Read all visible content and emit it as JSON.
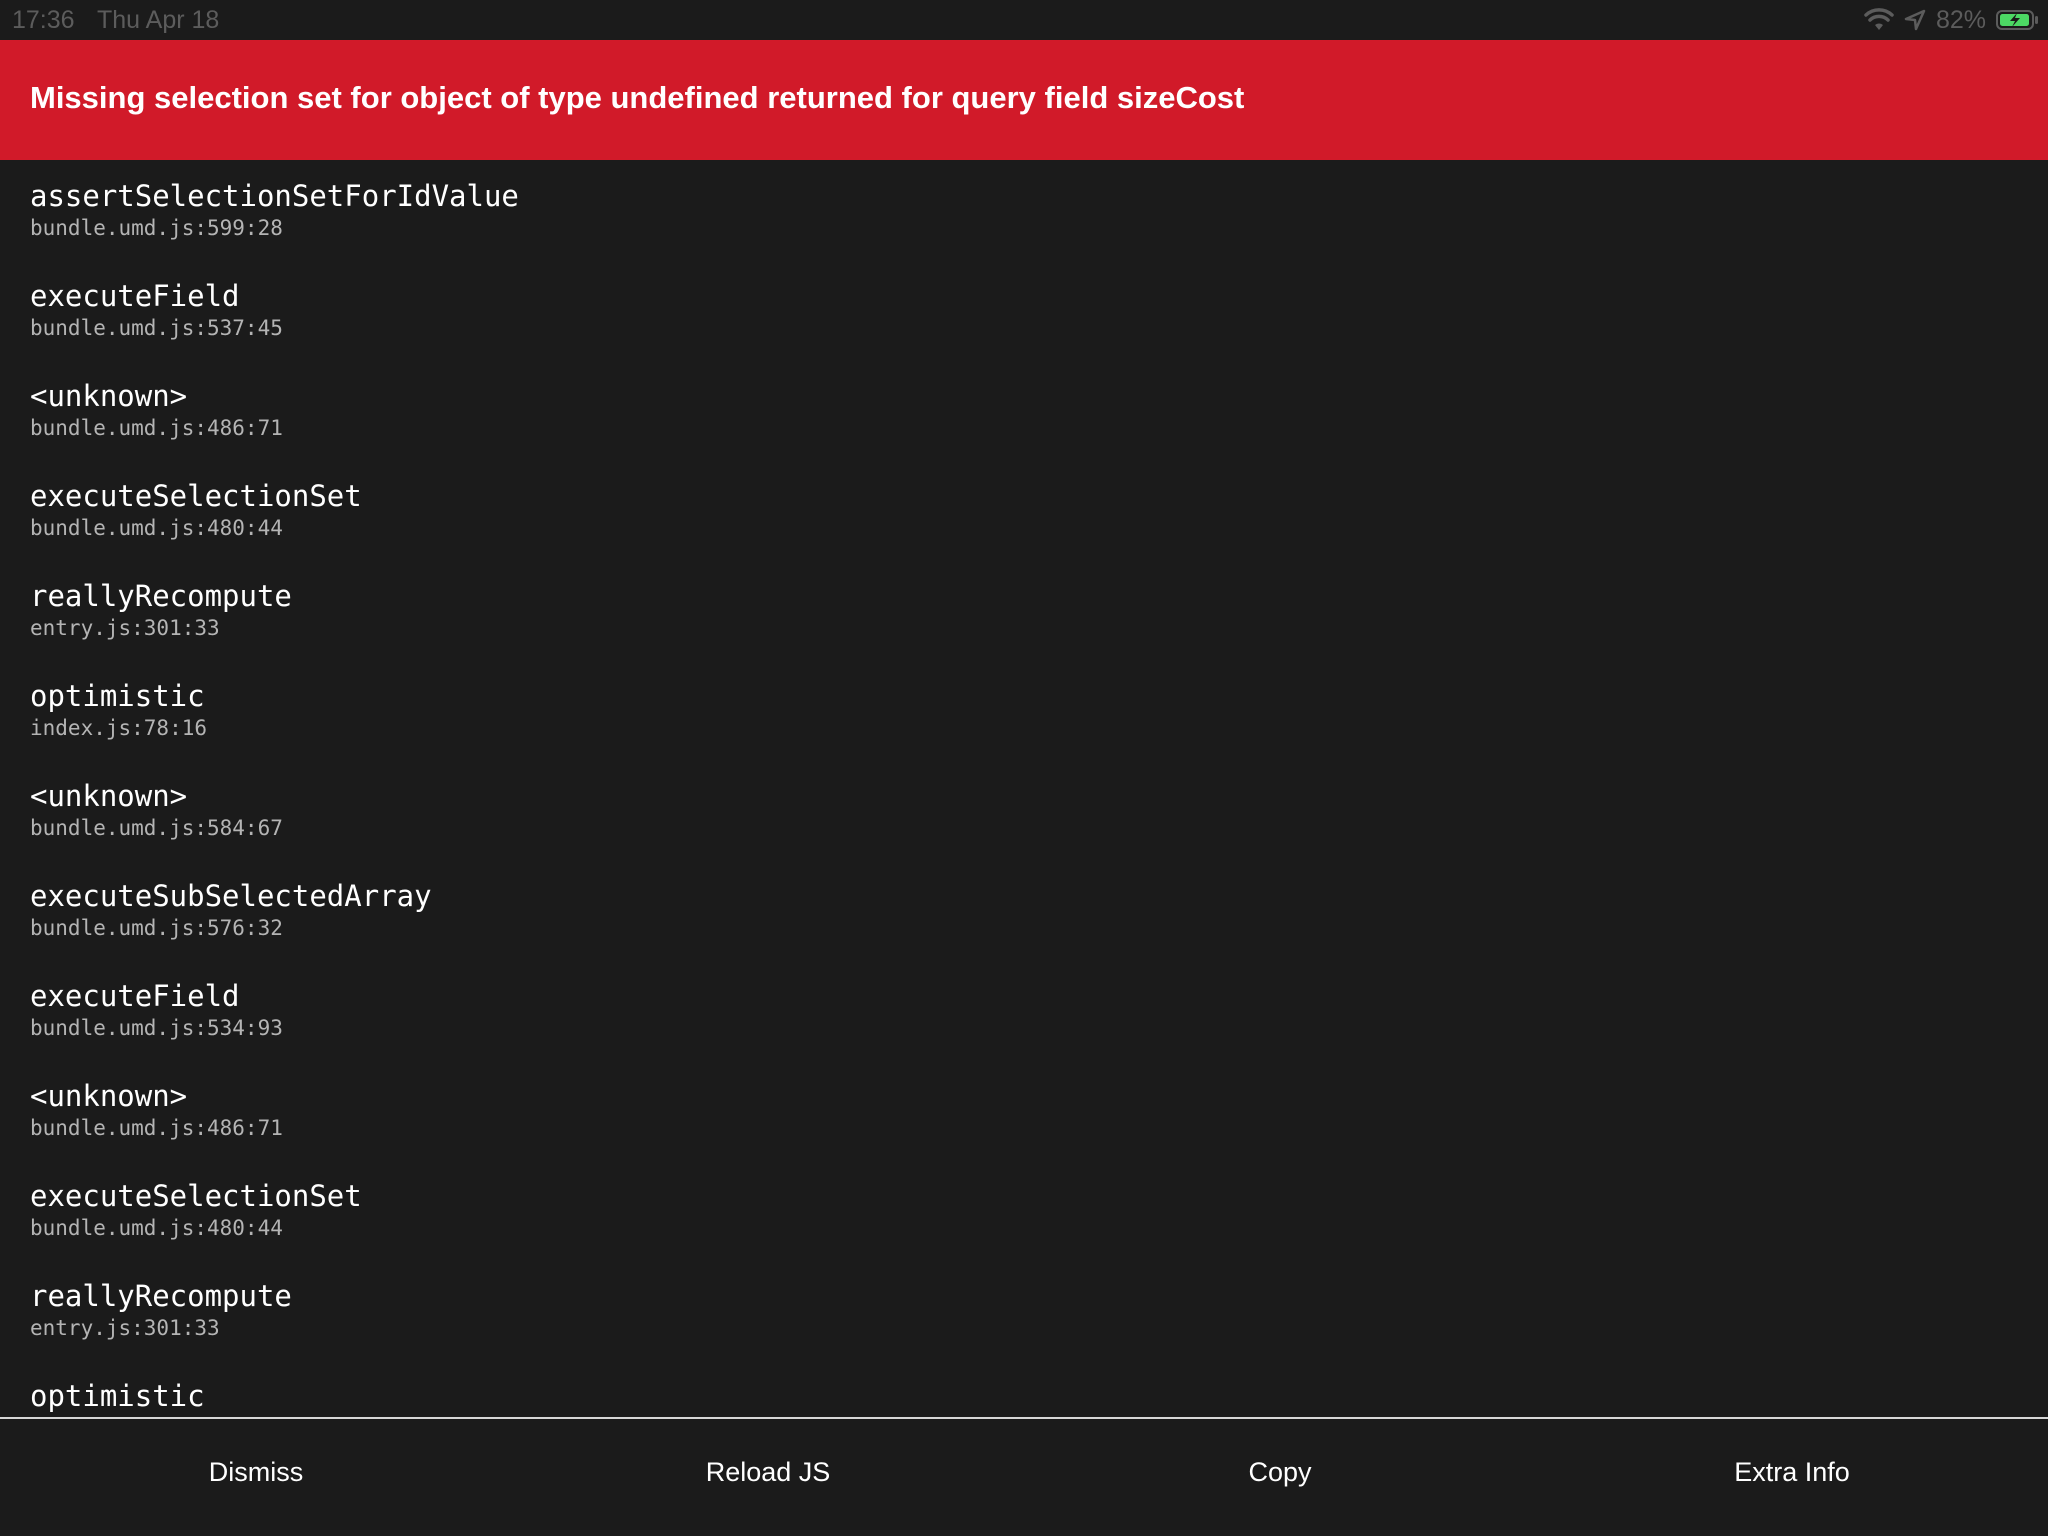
{
  "status_bar": {
    "time": "17:36",
    "date": "Thu Apr 18",
    "battery_percent": "82%",
    "icons": [
      "wifi-icon",
      "location-arrow-icon",
      "battery-charging-icon"
    ]
  },
  "error": {
    "message": "Missing selection set for object of type undefined returned for query field sizeCost"
  },
  "stack": [
    {
      "method": "assertSelectionSetForIdValue",
      "location": "bundle.umd.js:599:28"
    },
    {
      "method": "executeField",
      "location": "bundle.umd.js:537:45"
    },
    {
      "method": "<unknown>",
      "location": "bundle.umd.js:486:71"
    },
    {
      "method": "executeSelectionSet",
      "location": "bundle.umd.js:480:44"
    },
    {
      "method": "reallyRecompute",
      "location": "entry.js:301:33"
    },
    {
      "method": "optimistic",
      "location": "index.js:78:16"
    },
    {
      "method": "<unknown>",
      "location": "bundle.umd.js:584:67"
    },
    {
      "method": "executeSubSelectedArray",
      "location": "bundle.umd.js:576:32"
    },
    {
      "method": "executeField",
      "location": "bundle.umd.js:534:93"
    },
    {
      "method": "<unknown>",
      "location": "bundle.umd.js:486:71"
    },
    {
      "method": "executeSelectionSet",
      "location": "bundle.umd.js:480:44"
    },
    {
      "method": "reallyRecompute",
      "location": "entry.js:301:33"
    },
    {
      "method": "optimistic",
      "location": ""
    }
  ],
  "toolbar": {
    "dismiss_label": "Dismiss",
    "reload_label": "Reload JS",
    "copy_label": "Copy",
    "extra_info_label": "Extra Info"
  },
  "colors": {
    "background": "#1b1b1b",
    "banner": "#d11a29",
    "battery_fill": "#4cd964"
  }
}
